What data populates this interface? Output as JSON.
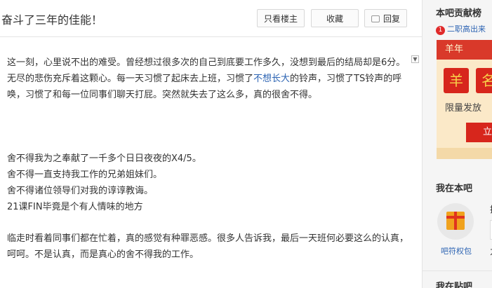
{
  "thread": {
    "title": "奋斗了三年的佳能！"
  },
  "actions": {
    "only_op": "只看楼主",
    "favorite": "收藏",
    "reply": "回复"
  },
  "post": {
    "p1_a": "这一刻，心里说不出的难受。曾经想过很多次的自己到底要工作多久，没想到最后的结局却是6分。无尽的悲伤充斥着这颗心。每一天习惯了起床去上班，习惯了",
    "p1_link": "不想长大",
    "p1_b": "的铃声，习惯了TS铃声的呼唤，习惯了和每一位同事们聊天打屁。突然就失去了这么多，真的很舍不得。",
    "lines": [
      "舍不得我为之奉献了一千多个日日夜夜的X4/5。",
      "舍不得一直支持我工作的兄弟姐妹们。",
      "舍不得诸位领导们对我的谆谆教诲。",
      "21课FIN毕竟是个有人情味的地方"
    ],
    "p3": "临走时看着同事们都在忙着，真的感觉有种罪恶感。很多人告诉我，最后一天班何必要这么的认真，呵呵。不是认真，而是真心的舍不得我的工作。"
  },
  "sidebar": {
    "contrib_title": "本吧贡献榜",
    "rank_badge": "1",
    "rank_text": "二职高出来",
    "promo_top": "羊年",
    "promo_tile1": "羊",
    "promo_tile2": "名",
    "promo_sub": "限量发放",
    "promo_btn": "立",
    "me_title": "我在本吧",
    "gift_label": "吧符权包",
    "field1": "技",
    "field3": "力",
    "post_bar_title": "我在贴吧"
  },
  "colors": {
    "link": "#2d64b3",
    "accent_red": "#d7261c"
  }
}
